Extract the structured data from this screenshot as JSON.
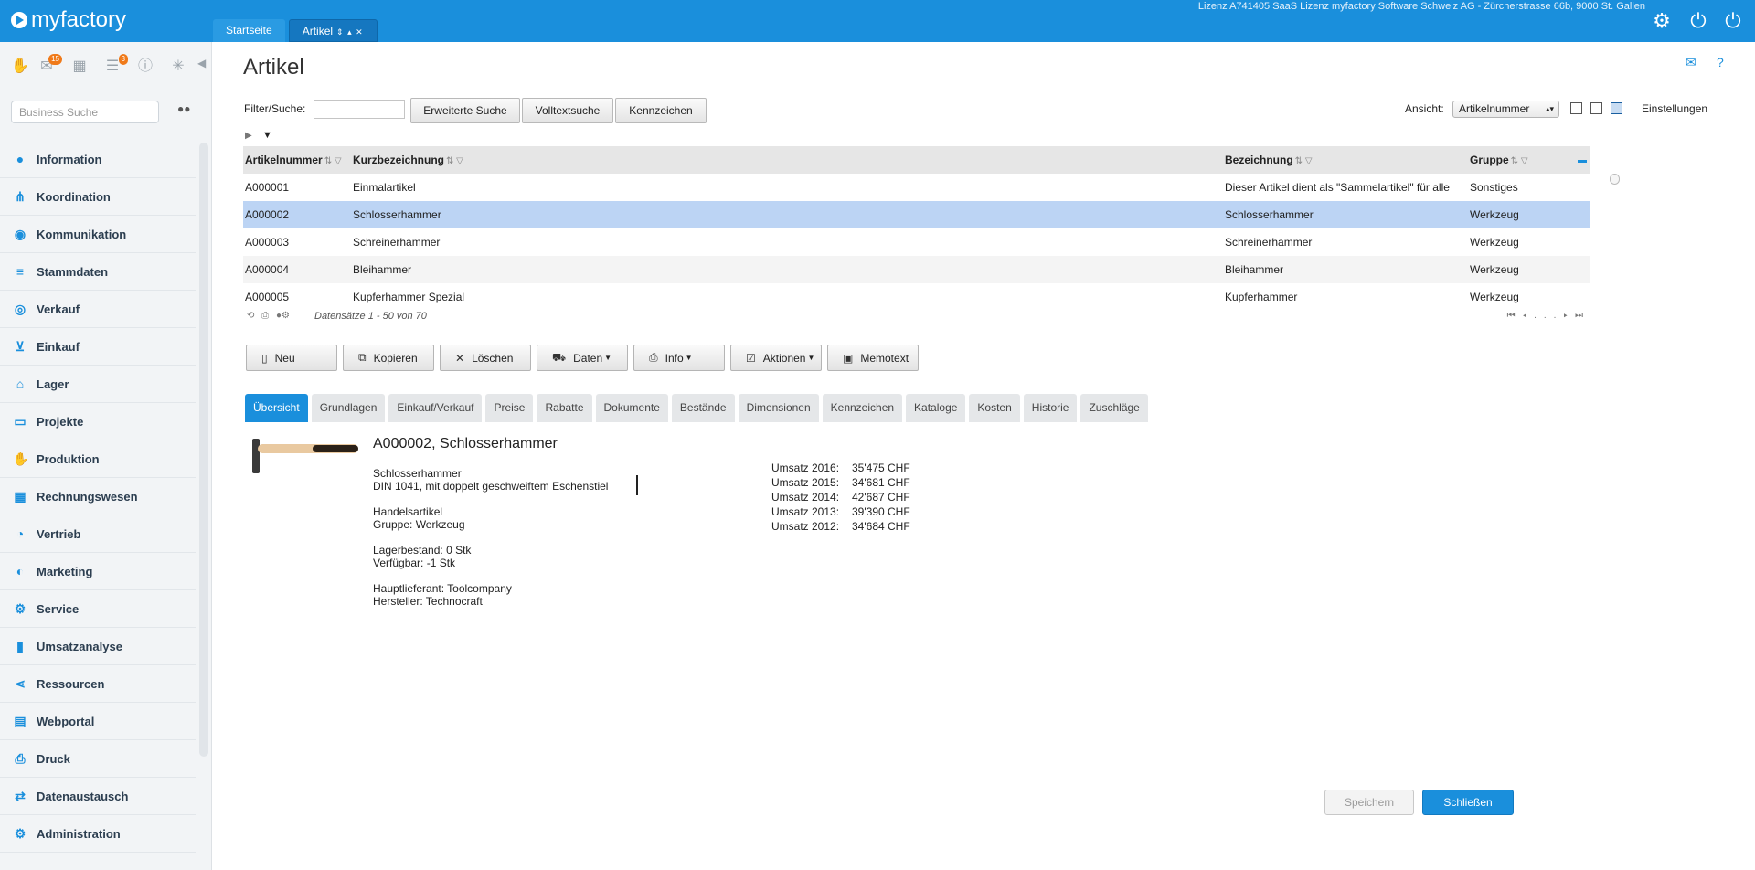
{
  "app": {
    "name": "myfactory"
  },
  "top_tabs": [
    {
      "label": "Startseite"
    },
    {
      "label": "Artikel",
      "controls": "⇕ ▴ ✕"
    }
  ],
  "license_text": "Lizenz A741405 SaaS Lizenz myfactory Software Schweiz AG - Zürcherstrasse 66b, 9000 St. Gallen",
  "sidebar": {
    "badges": {
      "notifications": "15",
      "tasks": "3"
    },
    "search_placeholder": "Business Suche",
    "items": [
      {
        "label": "Information",
        "icon": "info-icon"
      },
      {
        "label": "Koordination",
        "icon": "network-icon"
      },
      {
        "label": "Kommunikation",
        "icon": "chat-icon"
      },
      {
        "label": "Stammdaten",
        "icon": "database-icon"
      },
      {
        "label": "Verkauf",
        "icon": "coins-icon"
      },
      {
        "label": "Einkauf",
        "icon": "cart-icon"
      },
      {
        "label": "Lager",
        "icon": "warehouse-icon"
      },
      {
        "label": "Projekte",
        "icon": "presentation-icon"
      },
      {
        "label": "Produktion",
        "icon": "hand-gear-icon"
      },
      {
        "label": "Rechnungswesen",
        "icon": "grid-icon"
      },
      {
        "label": "Vertrieb",
        "icon": "gauge-icon"
      },
      {
        "label": "Marketing",
        "icon": "globe-icon"
      },
      {
        "label": "Service",
        "icon": "gear-icon"
      },
      {
        "label": "Umsatzanalyse",
        "icon": "bar-chart-icon"
      },
      {
        "label": "Ressourcen",
        "icon": "share-icon"
      },
      {
        "label": "Webportal",
        "icon": "www-icon"
      },
      {
        "label": "Druck",
        "icon": "printer-icon"
      },
      {
        "label": "Datenaustausch",
        "icon": "exchange-icon"
      },
      {
        "label": "Administration",
        "icon": "admin-gear-icon"
      }
    ]
  },
  "page": {
    "title": "Artikel",
    "filter_label": "Filter/Suche:",
    "filter_value": "",
    "buttons": {
      "extended_search": "Erweiterte Suche",
      "fulltext_search": "Volltextsuche",
      "marker": "Kennzeichen"
    },
    "view_label": "Ansicht:",
    "view_value": "Artikelnummer",
    "settings_label": "Einstellungen"
  },
  "grid": {
    "columns": [
      "Artikelnummer",
      "Kurzbezeichnung",
      "Bezeichnung",
      "Gruppe"
    ],
    "rows": [
      [
        "A000001",
        "Einmalartikel",
        "Dieser Artikel dient als \"Sammelartikel\" für alle",
        "Sonstiges"
      ],
      [
        "A000002",
        "Schlosserhammer",
        "Schlosserhammer",
        "Werkzeug"
      ],
      [
        "A000003",
        "Schreinerhammer",
        "Schreinerhammer",
        "Werkzeug"
      ],
      [
        "A000004",
        "Bleihammer",
        "Bleihammer",
        "Werkzeug"
      ],
      [
        "A000005",
        "Kupferhammer Spezial",
        "Kupferhammer",
        "Werkzeug"
      ]
    ],
    "selected_row": 1,
    "record_count": "Datensätze 1 - 50 von 70",
    "pager_ellipsis": "..."
  },
  "actions": {
    "new": "Neu",
    "copy": "Kopieren",
    "delete": "Löschen",
    "data": "Daten",
    "info": "Info",
    "actions": "Aktionen",
    "memo": "Memotext"
  },
  "detail_tabs": [
    "Übersicht",
    "Grundlagen",
    "Einkauf/Verkauf",
    "Preise",
    "Rabatte",
    "Dokumente",
    "Bestände",
    "Dimensionen",
    "Kennzeichen",
    "Kataloge",
    "Kosten",
    "Historie",
    "Zuschläge"
  ],
  "detail": {
    "title": "A000002, Schlosserhammer",
    "name": "Schlosserhammer",
    "description": "DIN 1041, mit doppelt geschweiftem Eschenstiel",
    "type": "Handelsartikel",
    "group": "Gruppe: Werkzeug",
    "stock": "Lagerbestand: 0 Stk",
    "available": "Verfügbar: -1 Stk",
    "supplier": "Hauptlieferant: Toolcompany",
    "manufacturer": "Hersteller: Technocraft",
    "sales": [
      {
        "label": "Umsatz 2016:",
        "value": "35'475 CHF"
      },
      {
        "label": "Umsatz 2015:",
        "value": "34'681 CHF"
      },
      {
        "label": "Umsatz 2014:",
        "value": "42'687 CHF"
      },
      {
        "label": "Umsatz 2013:",
        "value": "39'390 CHF"
      },
      {
        "label": "Umsatz 2012:",
        "value": "34'684 CHF"
      }
    ]
  },
  "footer": {
    "save": "Speichern",
    "close": "Schließen"
  }
}
